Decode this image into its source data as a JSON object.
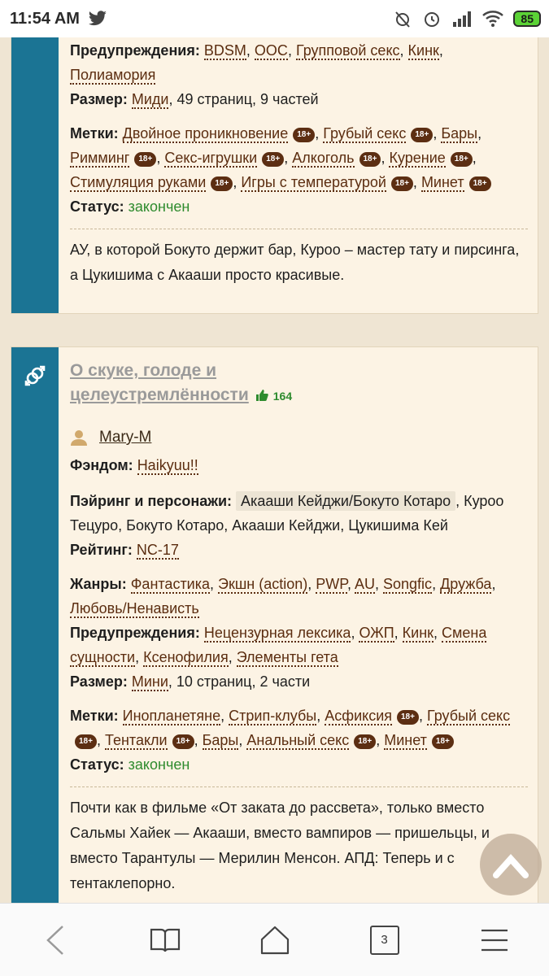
{
  "status_bar": {
    "time": "11:54 AM",
    "battery": "85"
  },
  "fic1": {
    "warnings_label": "Предупреждения:",
    "warnings": [
      "BDSM",
      "OOC",
      "Групповой секс",
      "Кинк",
      "Полиамория"
    ],
    "size_label": "Размер:",
    "size_link": "Миди",
    "size_rest": ", 49 страниц, 9 частей",
    "tags_label": "Метки:",
    "tags": [
      {
        "text": "Двойное проникновение",
        "badge": "18+"
      },
      {
        "text": "Грубый секс",
        "badge": "18+"
      },
      {
        "text": "Бары",
        "badge": ""
      },
      {
        "text": "Римминг",
        "badge": "18+"
      },
      {
        "text": "Секс-игрушки",
        "badge": "18+"
      },
      {
        "text": "Алкоголь",
        "badge": "18+"
      },
      {
        "text": "Курение",
        "badge": "18+"
      },
      {
        "text": "Стимуляция руками",
        "badge": "18+"
      },
      {
        "text": "Игры с температурой",
        "badge": "18+"
      },
      {
        "text": "Минет",
        "badge": "18+"
      }
    ],
    "status_label": "Статус:",
    "status": "закончен",
    "description": "АУ, в которой Бокуто держит бар, Куроо – мастер тату и пирсинга, а Цукишима с Акааши просто красивые."
  },
  "fic2": {
    "title_line1": "О скуке, голоде и",
    "title_line2": "целеустремлённости",
    "likes": "164",
    "author": "Mary-M",
    "fandom_label": "Фэндом:",
    "fandom": "Haikyuu!!",
    "pairing_label": "Пэйринг и персонажи:",
    "pairing_main": "Акааши Кейджи/Бокуто Котаро",
    "pairing_rest_1": ", Куроо",
    "pairing_rest_2": "Тецуро, Бокуто Котаро, Акааши Кейджи, Цукишима Кей",
    "rating_label": "Рейтинг:",
    "rating": "NC-17",
    "genres_label": "Жанры:",
    "genres": [
      "Фантастика",
      "Экшн (action)",
      "PWP",
      "AU",
      "Songfic",
      "Дружба",
      "Любовь/Ненависть"
    ],
    "warnings_label": "Предупреждения:",
    "warnings": [
      "Нецензурная лексика",
      "ОЖП",
      "Кинк",
      "Смена сущности",
      "Ксенофилия",
      "Элементы гета"
    ],
    "size_label": "Размер:",
    "size_link": "Мини",
    "size_rest": ", 10 страниц, 2 части",
    "tags_label": "Метки:",
    "tags": [
      {
        "text": "Инопланетяне",
        "badge": ""
      },
      {
        "text": "Стрип-клубы",
        "badge": ""
      },
      {
        "text": "Асфиксия",
        "badge": "18+"
      },
      {
        "text": "Грубый секс",
        "badge": "18+"
      },
      {
        "text": "Тентакли",
        "badge": "18+"
      },
      {
        "text": "Бары",
        "badge": ""
      },
      {
        "text": "Анальный секс",
        "badge": "18+"
      },
      {
        "text": "Минет",
        "badge": "18+"
      }
    ],
    "status_label": "Статус:",
    "status": "закончен",
    "description": "Почти как в фильме «От заката до рассвета», только вместо Сальмы Хайек — Акааши, вместо вампиров — пришельцы, и вместо Тарантулы — Мерилин Менсон. АПД: Теперь и с тентаклепорно."
  },
  "navbar": {
    "tabs_count": "3"
  },
  "colors": {
    "stripe": "#1b7494",
    "link": "#5b2d10",
    "status": "#2e8b2e",
    "badge": "#5c2e12"
  }
}
